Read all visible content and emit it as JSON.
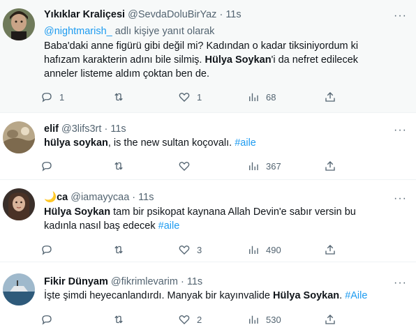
{
  "tweets": [
    {
      "name": "Yıkıklar Kraliçesi",
      "handle": "@SevdaDoluBirYaz",
      "separator": "·",
      "time": "11s",
      "reply_to": "@nightmarish_",
      "reply_suffix": " adlı kişiye yanıt olarak",
      "text_line1": "Baba'daki anne figürü gibi değil mi? Kadından o kadar tiksiniyordum ki",
      "text_line2": "hafızam karakterin adını bile silmiş. ",
      "text_bold": "Hülya Soykan",
      "text_line2b": "'i da nefret edilecek",
      "text_line3": "anneler listeme aldım çoktan ben de.",
      "replies": "1",
      "retweets": "",
      "likes": "1",
      "views": "68"
    },
    {
      "name": "elif",
      "handle": "@3lifs3rt",
      "separator": "·",
      "time": "11s",
      "text_bold": "hülya soykan",
      "text_rest": ", is the new sultan koçovalı. ",
      "hashtag": "#aile",
      "replies": "",
      "retweets": "",
      "likes": "",
      "views": "367"
    },
    {
      "name_emoji": "🌙",
      "name": "ca",
      "handle": "@iamayycaa",
      "separator": "·",
      "time": "11s",
      "text_bold": "Hülya Soykan",
      "text_rest": " tam bir psikopat kaynana Allah Devin'e sabır versin bu",
      "text_line2": "kadınla nasıl baş edecek ",
      "hashtag": "#aile",
      "replies": "",
      "retweets": "",
      "likes": "3",
      "views": "490"
    },
    {
      "name": "Fikir Dünyam",
      "handle": "@fikrimlevarim",
      "separator": "·",
      "time": "11s",
      "text_pre": "İşte şimdi heyecanlandırdı. Manyak bir kayınvalide ",
      "text_bold": "Hülya Soykan",
      "text_rest": ". ",
      "hashtag": "#Aile",
      "replies": "",
      "retweets": "",
      "likes": "2",
      "views": "530"
    }
  ]
}
